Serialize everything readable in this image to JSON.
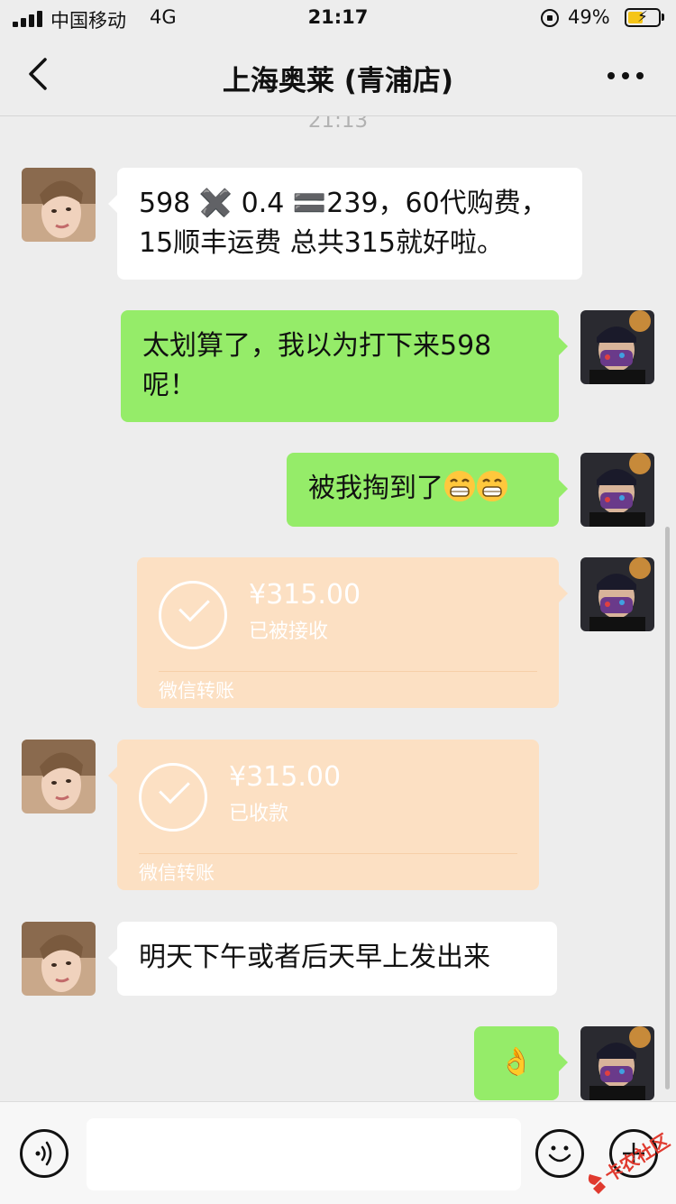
{
  "status_bar": {
    "carrier": "中国移动",
    "network": "4G",
    "time": "21:17",
    "battery_percent": "49%",
    "battery_level": 0.49
  },
  "header": {
    "title": "上海奥莱 (青浦店)",
    "back_icon": "chevron-left-icon",
    "more_icon": "more-dots-icon"
  },
  "chat": {
    "timestamp": "21:13",
    "messages": [
      {
        "side": "left",
        "type": "text",
        "lines": [
          "598 ✖️ 0.4 🟰239，60代购费，",
          "15顺丰运费 总共315就好啦。"
        ]
      },
      {
        "side": "right",
        "type": "text",
        "lines": [
          "太划算了，我以为打下来598",
          "呢！"
        ]
      },
      {
        "side": "right",
        "type": "text",
        "text": "被我掏到了",
        "emoji": "grin-face-icon"
      },
      {
        "side": "right",
        "type": "transfer",
        "amount": "¥315.00",
        "status": "已被接收",
        "footer": "微信转账"
      },
      {
        "side": "left",
        "type": "transfer",
        "amount": "¥315.00",
        "status": "已收款",
        "footer": "微信转账"
      },
      {
        "side": "left",
        "type": "text",
        "text": "明天下午或者后天早上发出来"
      },
      {
        "side": "right",
        "type": "emoji",
        "text": "👌"
      }
    ]
  },
  "input_bar": {
    "voice_icon": "voice-icon",
    "emoji_icon": "smiley-icon",
    "plus_icon": "plus-icon",
    "input_value": ""
  },
  "watermark": {
    "text": "卡农社区"
  },
  "colors": {
    "background": "#ededed",
    "green_bubble": "#95ec69",
    "transfer_bubble": "#fce0c3",
    "white_bubble": "#ffffff"
  }
}
